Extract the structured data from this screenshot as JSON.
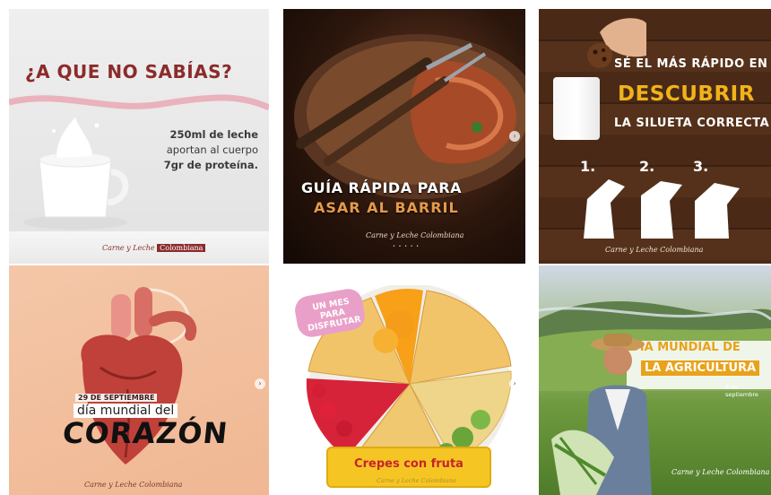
{
  "tiles": [
    {
      "title": "¿A QUE NO SABÍAS?",
      "fact_line1": "250ml de leche",
      "fact_line2": "aportan al cuerpo",
      "fact_line3": "7gr de proteína.",
      "brand": "Carne y Leche",
      "brand_highlight": "Colombiana"
    },
    {
      "headline_line1": "GUÍA RÁPIDA PARA",
      "headline_line2": "ASAR AL BARRIL",
      "brand": "Carne y Leche Colombiana",
      "dots": "• • • • •"
    },
    {
      "line1": "SÉ EL MÁS RÁPIDO EN",
      "line2": "DESCUBRIR",
      "line3": "LA SILUETA CORRECTA",
      "numbers": [
        "1.",
        "2.",
        "3."
      ],
      "brand": "Carne y Leche Colombiana"
    },
    {
      "date": "29 DE SEPTIEMBRE",
      "subtitle": "día mundial del",
      "big": "CORAZÓN",
      "brand": "Carne y Leche Colombiana"
    },
    {
      "tag": "UN MES PARA DISFRUTAR",
      "label": "Crepes con fruta",
      "brand": "Carne y Leche Colombiana"
    },
    {
      "line1": "DÍA MUNDIAL DE",
      "line2": "LA AGRICULTURA",
      "date": "8 de septiembre",
      "brand": "Carne y Leche Colombiana"
    }
  ],
  "next_glyph": "›",
  "colors": {
    "brand_red": "#8b2b2b",
    "orange": "#e69a4a",
    "yellow": "#f2b21a",
    "crepe_red": "#c8232c"
  }
}
